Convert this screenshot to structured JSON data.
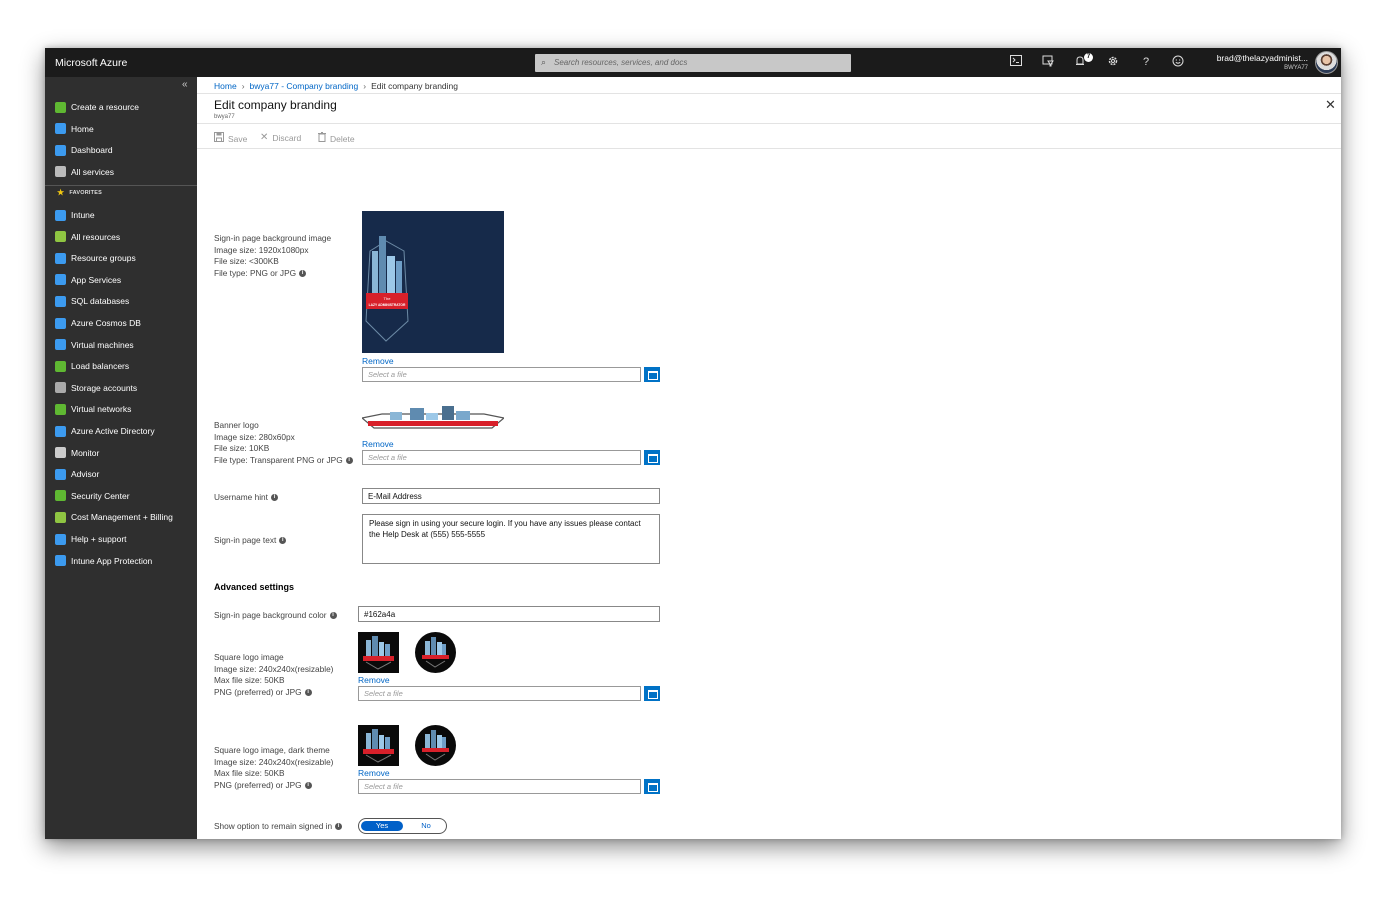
{
  "topbar": {
    "brand": "Microsoft Azure",
    "search_placeholder": "Search resources, services, and docs",
    "notification_count": "7",
    "user_email": "brad@thelazyadminist...",
    "tenant": "BWYA77"
  },
  "sidebar": {
    "collapse_glyph": "«",
    "items": [
      {
        "label": "Create a resource",
        "icon": "plus-icon",
        "color": "#5fb832"
      },
      {
        "label": "Home",
        "icon": "home-icon",
        "color": "#3c9bf0"
      },
      {
        "label": "Dashboard",
        "icon": "dashboard-icon",
        "color": "#3c9bf0"
      },
      {
        "label": "All services",
        "icon": "list-icon",
        "color": "#bbbbbb"
      }
    ],
    "favorites_label": "FAVORITES",
    "favorites": [
      {
        "label": "Intune",
        "icon": "intune-icon",
        "color": "#3c9bf0"
      },
      {
        "label": "All resources",
        "icon": "grid-icon",
        "color": "#8fc542"
      },
      {
        "label": "Resource groups",
        "icon": "cube-icon",
        "color": "#3c9bf0"
      },
      {
        "label": "App Services",
        "icon": "globe-icon",
        "color": "#3c9bf0"
      },
      {
        "label": "SQL databases",
        "icon": "sql-icon",
        "color": "#3c9bf0"
      },
      {
        "label": "Azure Cosmos DB",
        "icon": "planet-icon",
        "color": "#3c9bf0"
      },
      {
        "label": "Virtual machines",
        "icon": "monitor-icon",
        "color": "#3c9bf0"
      },
      {
        "label": "Load balancers",
        "icon": "diamond-icon",
        "color": "#5fb832"
      },
      {
        "label": "Storage accounts",
        "icon": "storage-icon",
        "color": "#aaaaaa"
      },
      {
        "label": "Virtual networks",
        "icon": "network-icon",
        "color": "#5fb832"
      },
      {
        "label": "Azure Active Directory",
        "icon": "aad-icon",
        "color": "#3c9bf0"
      },
      {
        "label": "Monitor",
        "icon": "gauge-icon",
        "color": "#cccccc"
      },
      {
        "label": "Advisor",
        "icon": "cloud-icon",
        "color": "#3c9bf0"
      },
      {
        "label": "Security Center",
        "icon": "shield-icon",
        "color": "#5fb832"
      },
      {
        "label": "Cost Management + Billing",
        "icon": "cost-icon",
        "color": "#8fc542"
      },
      {
        "label": "Help + support",
        "icon": "person-icon",
        "color": "#3c9bf0"
      },
      {
        "label": "Intune App Protection",
        "icon": "app-protection-icon",
        "color": "#3c9bf0"
      }
    ]
  },
  "breadcrumb": {
    "home": "Home",
    "parent": "bwya77 - Company branding",
    "current": "Edit company branding"
  },
  "page": {
    "title": "Edit company branding",
    "subtitle": "bwya77",
    "close_glyph": "✕"
  },
  "toolbar": {
    "save": "Save",
    "discard": "Discard",
    "delete": "Delete"
  },
  "form": {
    "bg_image": {
      "title": "Sign-in page background image",
      "size": "Image size: 1920x1080px",
      "filesize": "File size: <300KB",
      "filetype": "File type: PNG or JPG",
      "remove": "Remove",
      "placeholder": "Select a file",
      "color": "#162a4a"
    },
    "banner": {
      "title": "Banner logo",
      "size": "Image size: 280x60px",
      "filesize": "File size: 10KB",
      "filetype": "File type: Transparent PNG or JPG",
      "remove": "Remove",
      "placeholder": "Select a file"
    },
    "username_hint": {
      "label": "Username hint",
      "value": "E-Mail Address"
    },
    "signin_text": {
      "label": "Sign-in page text",
      "value": "Please sign in using your secure login. If you have any issues please contact the Help Desk at (555) 555-5555"
    },
    "advanced_heading": "Advanced settings",
    "bg_color": {
      "label": "Sign-in page background color",
      "value": "#162a4a"
    },
    "square_logo": {
      "title": "Square logo image",
      "size": "Image size: 240x240x(resizable)",
      "filesize": "Max file size: 50KB",
      "filetype": "PNG (preferred) or JPG",
      "remove": "Remove",
      "placeholder": "Select a file"
    },
    "square_logo_dark": {
      "title": "Square logo image, dark theme",
      "size": "Image size: 240x240x(resizable)",
      "filesize": "Max file size: 50KB",
      "filetype": "PNG (preferred) or JPG",
      "remove": "Remove",
      "placeholder": "Select a file"
    },
    "remain_signed_in": {
      "label": "Show option to remain signed in",
      "yes": "Yes",
      "no": "No",
      "selected": "Yes"
    }
  },
  "logo_text": {
    "the": "The",
    "name": "LAZY ADMINISTRATOR"
  },
  "colors": {
    "accent": "#0072c6",
    "link": "#0066c6",
    "topbar": "#1b1b1b",
    "sidebar": "#2f2f2f"
  }
}
